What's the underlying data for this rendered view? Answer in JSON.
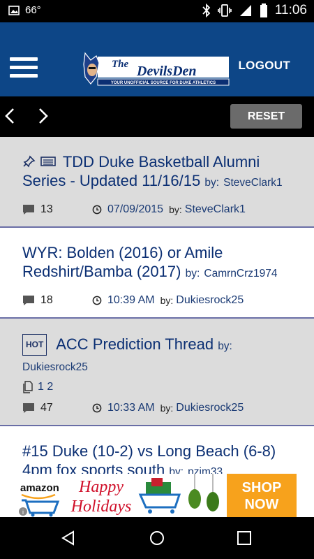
{
  "status_bar": {
    "temperature": "66°",
    "time": "11:06"
  },
  "header": {
    "logo_line1": "The",
    "logo_line2": "DevilsDen",
    "logo_tagline": "YOUR UNOFFICIAL SOURCE FOR DUKE ATHLETICS",
    "logout_label": "LOGOUT"
  },
  "toolbar": {
    "reset_label": "RESET"
  },
  "threads": [
    {
      "title": "TDD Duke Basketball Alumni Series - Updated 11/16/15",
      "by_label": "by:",
      "author": "SteveClark1",
      "comments": "13",
      "time": "07/09/2015",
      "by_label2": "by:",
      "last_user": "SteveClark1"
    },
    {
      "title": "WYR: Bolden (2016) or Amile Redshirt/Bamba (2017)",
      "by_label": "by:",
      "author": "CamrnCrz1974",
      "comments": "18",
      "time": "10:39 AM",
      "by_label2": "by:",
      "last_user": "Dukiesrock25"
    },
    {
      "badge": "HOT",
      "title": "ACC Prediction Thread",
      "by_label": "by:",
      "author": "Dukiesrock25",
      "pages": "1 2",
      "comments": "47",
      "time": "10:33 AM",
      "by_label2": "by:",
      "last_user": "Dukiesrock25"
    },
    {
      "title": "#15 Duke (10-2) vs Long Beach (6-8) 4pm fox sports south",
      "by_label": "by:",
      "author": "pzim33"
    }
  ],
  "ad": {
    "brand": "amazon",
    "line1": "Happy",
    "line2": "Holidays",
    "cta_line1": "SHOP",
    "cta_line2": "NOW"
  },
  "colors": {
    "header_bg": "#0d4687",
    "thread_gray": "#dcdcdc",
    "title": "#0b2f73",
    "ad_cta": "#f7a21c"
  }
}
